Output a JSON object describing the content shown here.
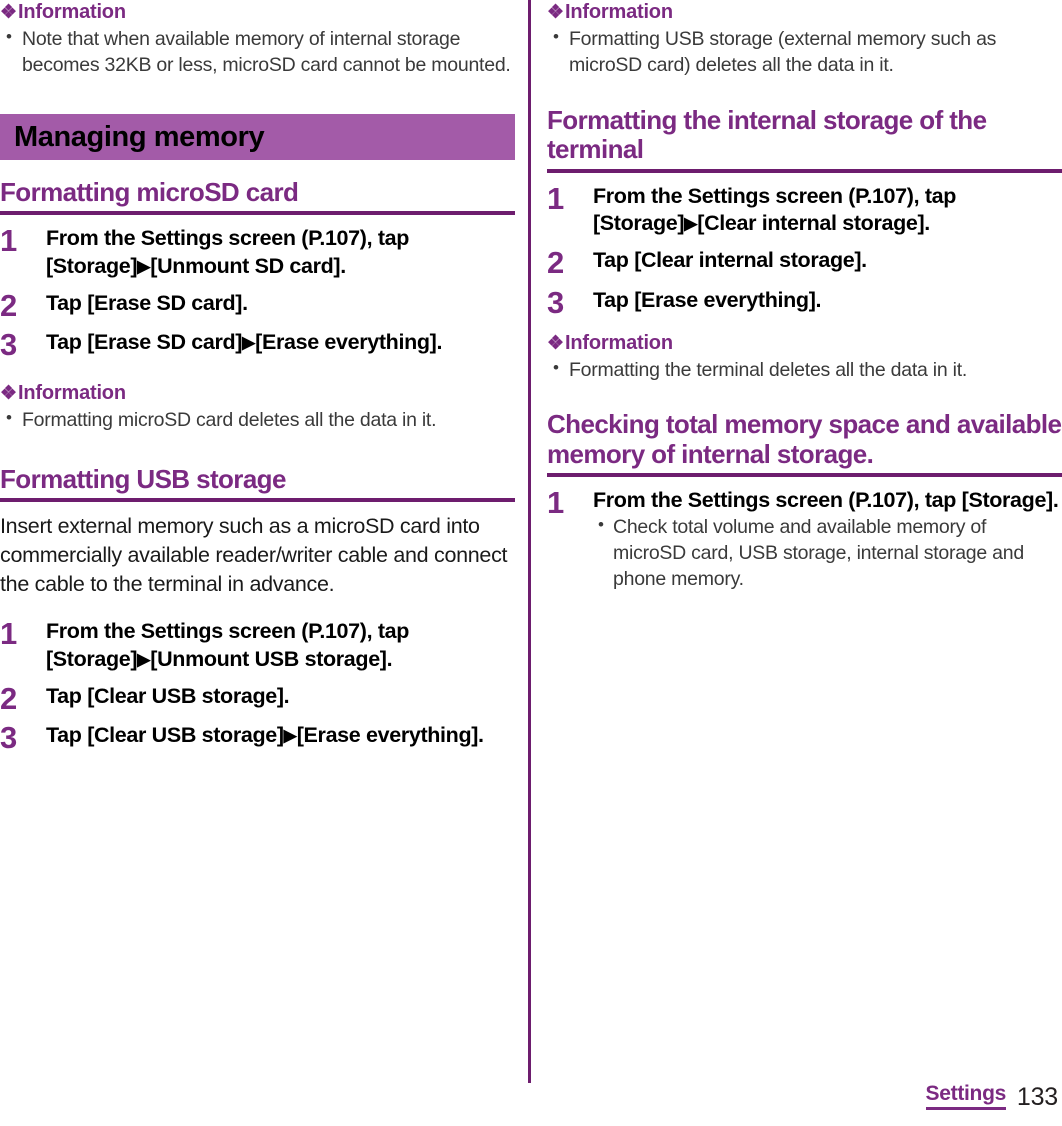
{
  "colors": {
    "heading_purple": "#7B2A82",
    "rule_purple": "#6d1d6e",
    "banner_purple": "#A35BA8",
    "body_gray": "#3a3a3a"
  },
  "icons": {
    "diamond": "❖",
    "arrow": "▶",
    "bullet": "•"
  },
  "left_column": {
    "info_1": {
      "heading": "Information",
      "bullets": [
        "Note that when available memory of internal storage becomes 32KB or less, microSD card cannot be mounted."
      ]
    },
    "banner": "Managing memory",
    "section_1": {
      "heading": "Formatting microSD card",
      "steps": [
        {
          "num": "1",
          "text_parts": [
            "From the Settings screen (P.107), tap [Storage]",
            "▶",
            "[Unmount SD card]."
          ]
        },
        {
          "num": "2",
          "text_parts": [
            "Tap [Erase SD card]."
          ]
        },
        {
          "num": "3",
          "text_parts": [
            "Tap [Erase SD card]",
            "▶",
            "[Erase everything]."
          ]
        }
      ],
      "info": {
        "heading": "Information",
        "bullets": [
          "Formatting microSD card deletes all the data in it."
        ]
      }
    },
    "section_2": {
      "heading": "Formatting USB storage",
      "paragraph": "Insert external memory such as a microSD card into commercially available reader/writer cable and connect the cable to the terminal in advance.",
      "steps": [
        {
          "num": "1",
          "text_parts": [
            "From the Settings screen (P.107), tap [Storage]",
            "▶",
            "[Unmount USB storage]."
          ]
        },
        {
          "num": "2",
          "text_parts": [
            "Tap [Clear USB storage]."
          ]
        },
        {
          "num": "3",
          "text_parts": [
            "Tap [Clear USB storage]",
            "▶",
            "[Erase everything]."
          ]
        }
      ]
    }
  },
  "right_column": {
    "info_1": {
      "heading": "Information",
      "bullets": [
        "Formatting USB storage (external memory such as microSD card) deletes all the data in it."
      ]
    },
    "section_1": {
      "heading": "Formatting the internal storage of the terminal",
      "steps": [
        {
          "num": "1",
          "text_parts": [
            "From the Settings screen (P.107), tap [Storage]",
            "▶",
            "[Clear internal storage]."
          ]
        },
        {
          "num": "2",
          "text_parts": [
            "Tap [Clear internal storage]."
          ]
        },
        {
          "num": "3",
          "text_parts": [
            "Tap [Erase everything]."
          ]
        }
      ],
      "info": {
        "heading": "Information",
        "bullets": [
          "Formatting the terminal deletes all the data in it."
        ]
      }
    },
    "section_2": {
      "heading": "Checking total memory space and available memory of internal storage.",
      "steps": [
        {
          "num": "1",
          "text_parts": [
            "From the Settings screen (P.107), tap [Storage]."
          ],
          "substeps": [
            "Check total volume and available memory of microSD card, USB storage, internal storage and phone memory."
          ]
        }
      ]
    }
  },
  "footer": {
    "chapter": "Settings",
    "page_number": "133"
  }
}
